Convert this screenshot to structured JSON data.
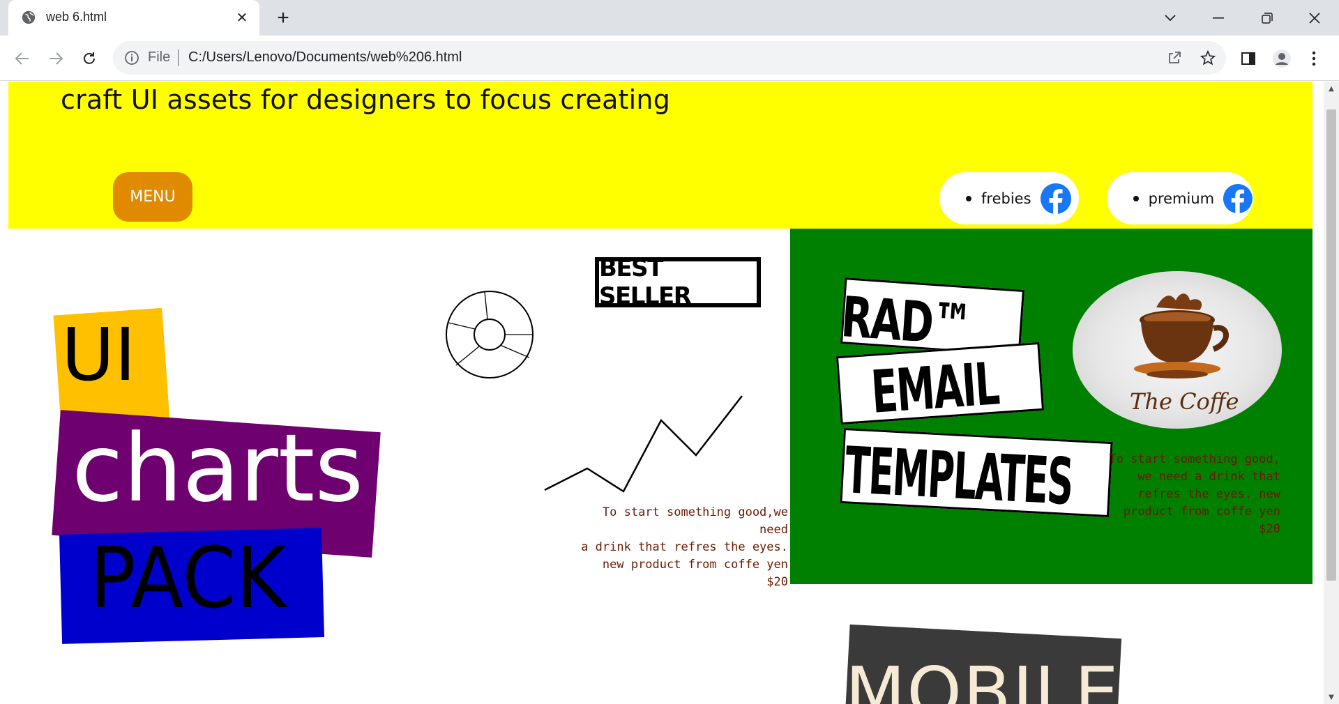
{
  "browser": {
    "tab_title": "web 6.html",
    "url_scheme": "File",
    "url": "C:/Users/Lenovo/Documents/web%206.html"
  },
  "page": {
    "tagline": "craft UI assets for designers to focus creating",
    "menu_label": "MENU",
    "nav_pills": [
      {
        "label": "frebies",
        "icon": "facebook-icon"
      },
      {
        "label": "premium",
        "icon": "facebook-icon"
      }
    ],
    "hero_words": {
      "ui": "UI",
      "charts": "charts",
      "pack": "PACK"
    },
    "best_seller": "BEST SELLER",
    "promo_left": [
      "To start something good,we need",
      "a drink that refres the eyes.",
      "new product from coffe yen",
      "$20"
    ],
    "promo_right": [
      "To start something good,",
      "we need a drink that",
      "refres the eyes. new",
      "product from coffe yen",
      "$20"
    ],
    "rad": {
      "line1": "RAD™",
      "line2": "EMAIL",
      "line3": "TEMPLATES"
    },
    "coffee_label": "The Coffe",
    "mobile": "MOBILE"
  },
  "colors": {
    "hero_bg": "#ffff00",
    "menu_bg": "#e08a00",
    "green_panel": "#008000",
    "ui_block": "#ffc000",
    "charts_block": "#6f006f",
    "pack_block": "#0000cc",
    "facebook": "#1877f2"
  }
}
